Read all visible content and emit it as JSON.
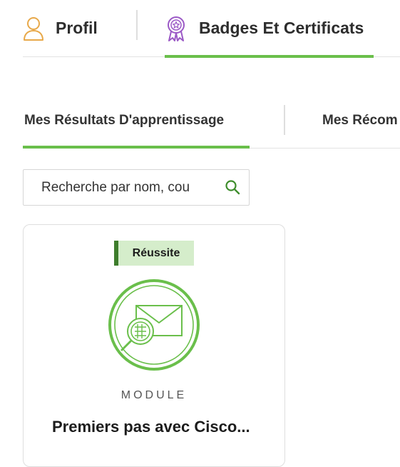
{
  "top_tabs": [
    {
      "label": "Profil",
      "icon": "user-icon",
      "active": false
    },
    {
      "label": "Badges Et Certificats",
      "icon": "award-badge-icon",
      "active": true
    }
  ],
  "sub_tabs": [
    {
      "label": "Mes Résultats D'apprentissage",
      "active": true
    },
    {
      "label": "Mes Récom",
      "active": false
    }
  ],
  "search": {
    "placeholder": "Recherche par nom, cou",
    "icon": "search-icon"
  },
  "cards": [
    {
      "status": "Réussite",
      "type": "MODULE",
      "title": "Premiers pas avec Cisco...",
      "icon": "email-search-icon"
    }
  ],
  "colors": {
    "accent": "#6abf4b",
    "status_bg": "#d5edcb",
    "status_bar": "#3e7d2c",
    "profile_icon": "#e8a94a",
    "badge_icon": "#9b59c6"
  }
}
